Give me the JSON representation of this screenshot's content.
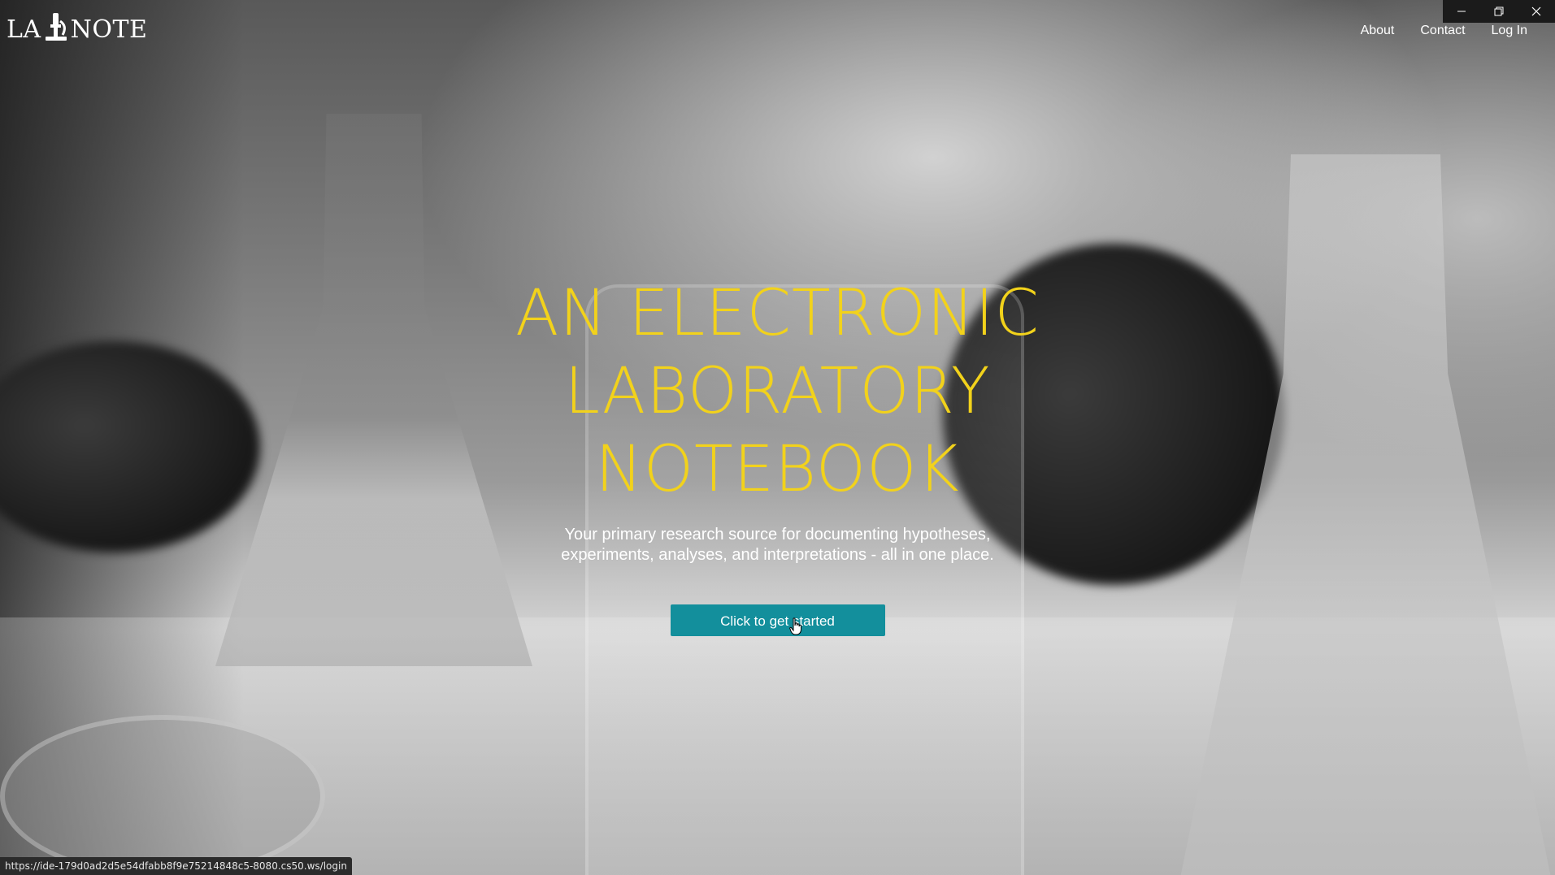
{
  "brand": {
    "logo_left": "LA",
    "logo_right": "NOTE",
    "logo_mark": "microscope-icon"
  },
  "nav": {
    "items": [
      "About",
      "Contact",
      "Log In"
    ]
  },
  "window_controls": {
    "minimize": "minimize-icon",
    "restore": "restore-icon",
    "close": "close-icon"
  },
  "hero": {
    "title_lines": [
      "AN ELECTRONIC",
      "LABORATORY",
      "NOTEBOOK"
    ],
    "subtitle_lines": [
      "Your primary research source for documenting hypotheses,",
      "experiments, analyses, and interpretations - all in one place."
    ],
    "cta_label": "Click to get started"
  },
  "status_url": "https://ide-179d0ad2d5e54dfabb8f9e75214848c5-8080.cs50.ws/login",
  "colors": {
    "title": "#f2d21b",
    "cta_bg": "#138f9c",
    "text": "#ffffff"
  }
}
